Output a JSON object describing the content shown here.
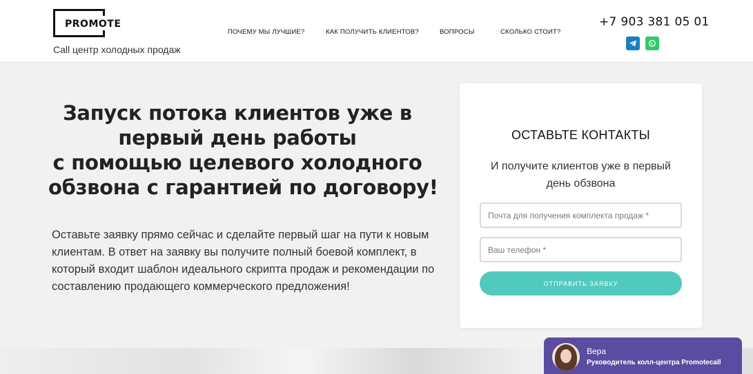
{
  "header": {
    "logo": "PROMOTE",
    "tagline": "Call центр холодных продаж",
    "nav": [
      {
        "label": "ПОЧЕМУ МЫ ЛУЧШИЕ?"
      },
      {
        "label": "КАК ПОЛУЧИТЬ КЛИЕНТОВ?"
      },
      {
        "label": "ВОПРОСЫ"
      },
      {
        "label": "СКОЛЬКО СТОИТ?"
      }
    ],
    "phone": "+7 903 381 05 01",
    "social": [
      {
        "icon": "telegram-icon",
        "color": "#1a7fc2"
      },
      {
        "icon": "whatsapp-icon",
        "color": "#2fc96c"
      }
    ]
  },
  "hero": {
    "title_lines": [
      "Запуск потока клиентов уже в",
      "первый день работы",
      "с помощью целевого холодного",
      "обзвона с гарантией по договору!"
    ],
    "text": "Оставьте заявку прямо сейчас и сделайте первый шаг на пути к новым клиентам. В ответ на заявку вы получите полный боевой комплект, в который входит шаблон идеального скрипта продаж и рекомендации по составлению продающего коммерческого предложения!"
  },
  "form": {
    "title": "ОСТАВЬТЕ КОНТАКТЫ",
    "subtitle_lines": [
      "И получите клиентов уже в первый",
      "день обзвона"
    ],
    "email_placeholder": "Почта для получения комплекта продаж *",
    "phone_placeholder": "Ваш телефон *",
    "submit_label": "ОТПРАВИТЬ ЗАЯВКУ",
    "accent_color": "#52c9bd"
  },
  "chat": {
    "name": "Вера",
    "role": "Руководитель колл-центра Promotecall",
    "color": "#5a4ca0"
  }
}
